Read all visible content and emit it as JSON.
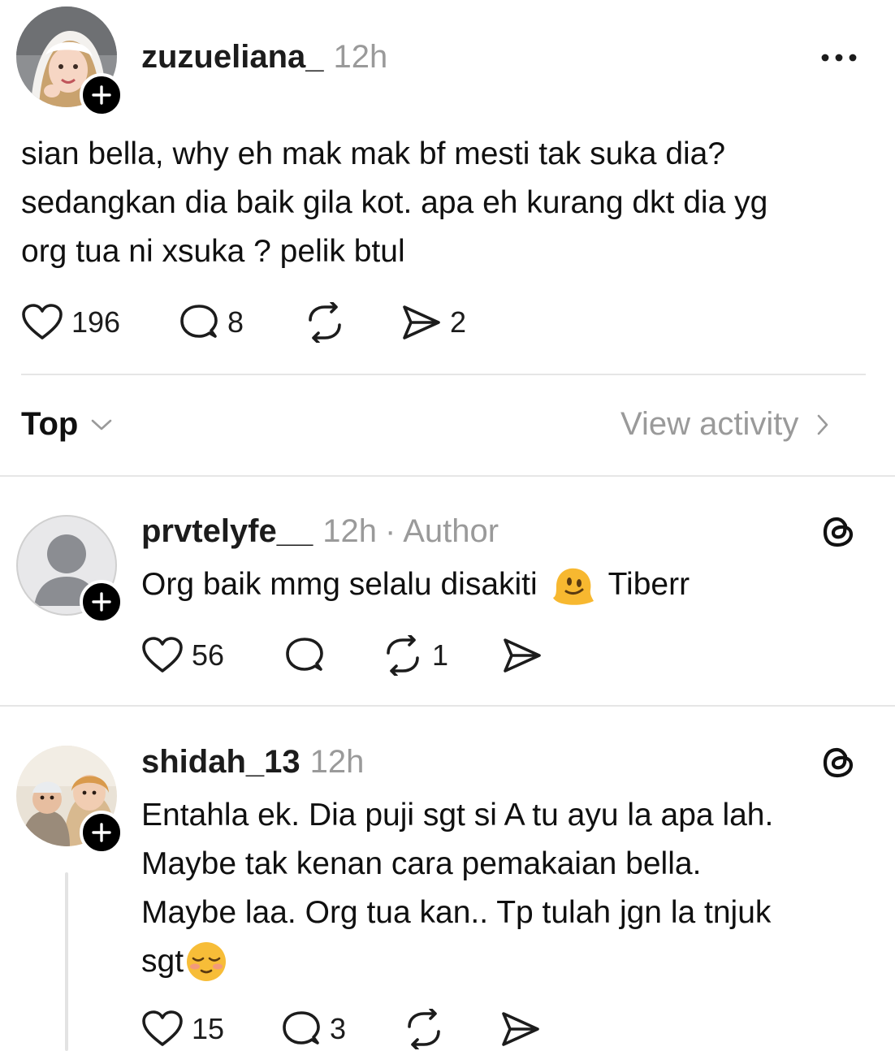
{
  "post": {
    "username": "zuzueliana_",
    "time": "12h",
    "text_lines": [
      "sian bella, why eh mak mak bf mesti tak suka dia?",
      "sedangkan dia baik gila kot. apa eh kurang dkt dia yg",
      "org tua ni xsuka ? pelik btul"
    ],
    "likes": "196",
    "comments": "8",
    "shares": "2"
  },
  "sort": {
    "label": "Top",
    "view_activity": "View activity"
  },
  "replies": [
    {
      "username": "prvtelyfe__",
      "time": "12h",
      "author_label": "· Author",
      "text_before_emoji": "Org baik mmg selalu disakiti",
      "text_after_emoji": "Tiberr",
      "likes": "56",
      "reposts": "1"
    },
    {
      "username": "shidah_13",
      "time": "12h",
      "text_lines": [
        "Entahla ek. Dia puji sgt si A tu ayu la apa lah.",
        "Maybe tak kenan cara pemakaian bella.",
        "Maybe laa. Org tua kan.. Tp tulah jgn la tnjuk",
        "sgt"
      ],
      "likes": "15",
      "comments": "3"
    }
  ],
  "colors": {
    "text": "#101010",
    "muted": "#9a9a9a",
    "divider": "#e6e6e6"
  },
  "icons": [
    "more-icon",
    "heart-icon",
    "comment-icon",
    "repost-icon",
    "share-icon",
    "chevron-down-icon",
    "chevron-right-icon",
    "threads-icon",
    "follow-plus-icon"
  ]
}
